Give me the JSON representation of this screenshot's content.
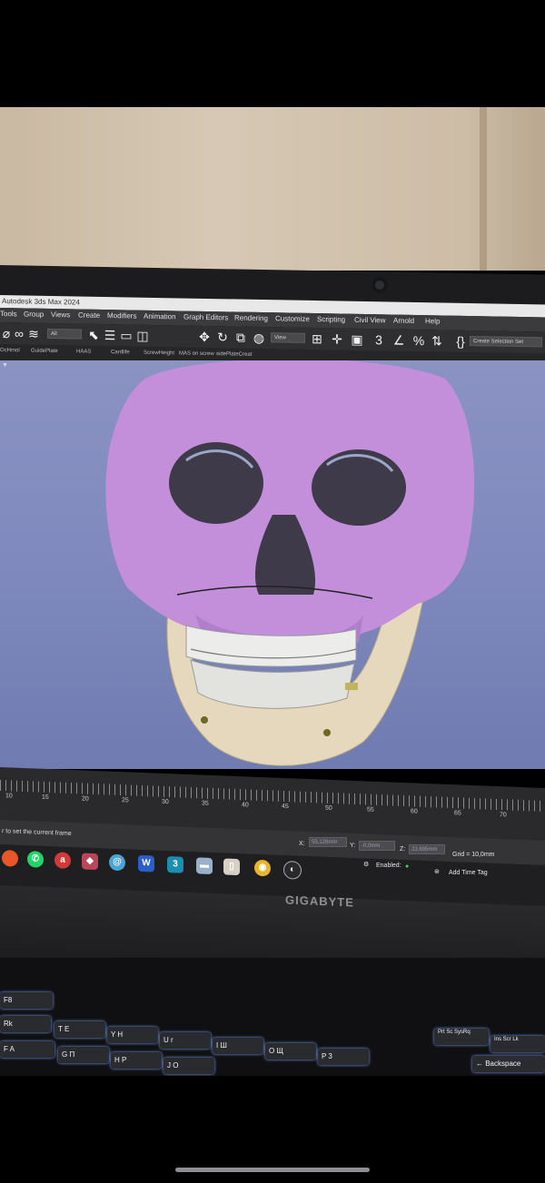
{
  "window": {
    "title": "Autodesk 3ds Max 2024"
  },
  "menu": [
    "Tools",
    "Group",
    "Views",
    "Create",
    "Modifiers",
    "Animation",
    "Graph Editors",
    "Rendering",
    "Customize",
    "Scripting",
    "Civil View",
    "Arnold",
    "Help"
  ],
  "toolbar": {
    "filter_dropdown": "All",
    "view_dropdown": "View",
    "selection_set": "Create Selection Set"
  },
  "ribbon": [
    "OcHmol",
    "GuidePlate",
    "HAAS",
    "Cardlife",
    "ScrewHeight",
    "MAS on screw",
    "sidePlateCreat"
  ],
  "timeline": {
    "ticks": [
      "10",
      "15",
      "20",
      "25",
      "30",
      "35",
      "40",
      "45",
      "50",
      "55",
      "60",
      "65",
      "70"
    ]
  },
  "status": {
    "message": "r to set the current frame",
    "x_label": "X:",
    "x_value": "55,126mm",
    "y_label": "Y:",
    "y_value": "-0,0mm",
    "z_label": "Z:",
    "z_value": "23,695mm",
    "grid": "Grid = 10,0mm",
    "enabled": "Enabled:",
    "add_time_tag": "Add Time Tag"
  },
  "brand": "GIGABYTE",
  "keys": [
    "F8",
    "Rk",
    "T E",
    "Y H",
    "U r",
    "I Ш",
    "O Щ",
    "P 3",
    "F A",
    "G П",
    "H P",
    "J O",
    "Ins Scr Lk",
    "Prt Sc SysRq",
    "← Backspace"
  ],
  "colors": {
    "skull": "#c38fda",
    "jaw": "#e6d8bd",
    "viewport": "#7f89bd"
  }
}
